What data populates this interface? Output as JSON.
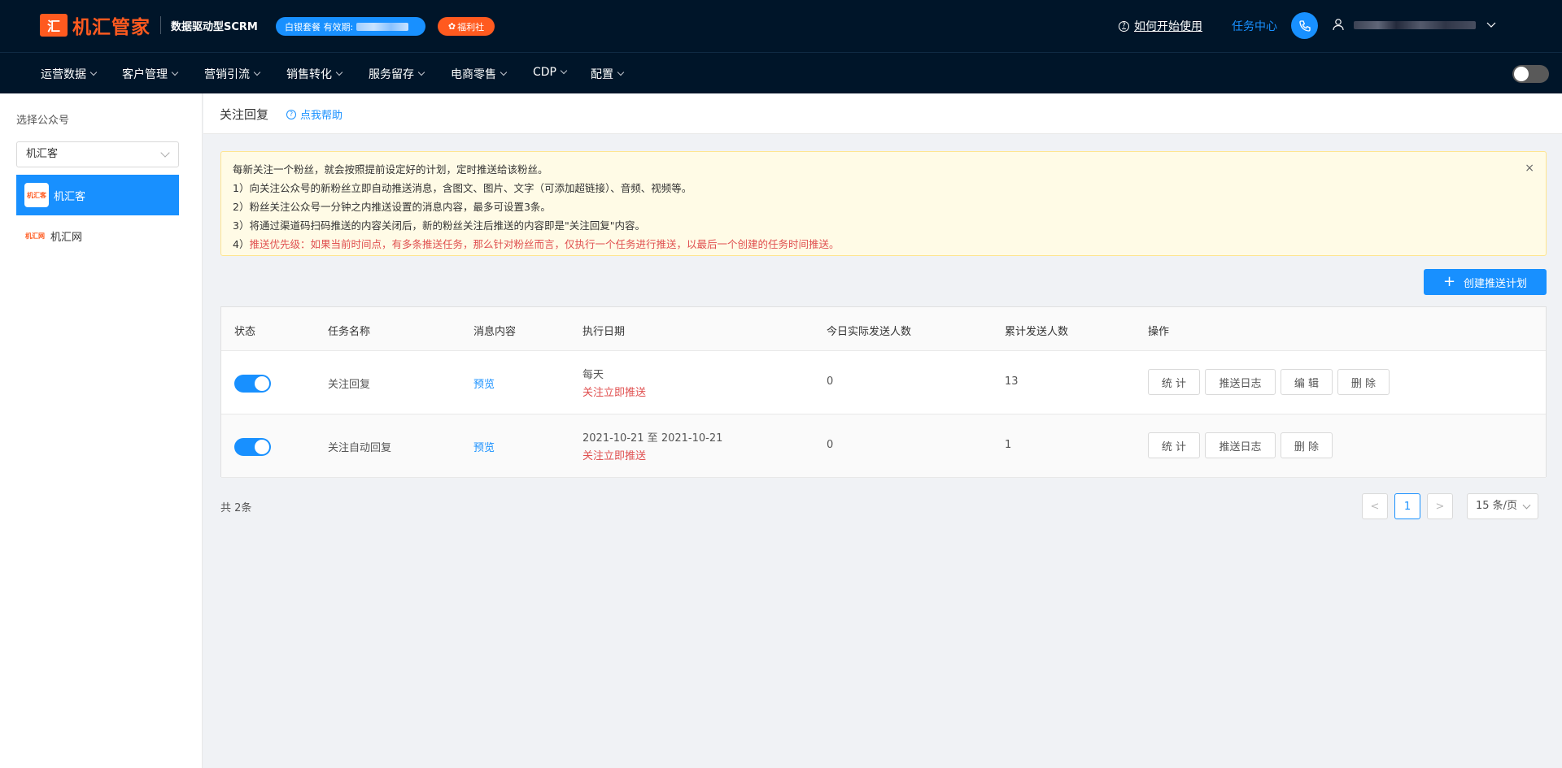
{
  "header": {
    "logo_mark": "汇",
    "logo_text": "机汇管家",
    "slogan": "数据驱动型SCRM",
    "plan_label": "白银套餐  有效期:",
    "welfare_label": "福利社",
    "help_label": "如何开始使用",
    "task_center": "任务中心"
  },
  "nav": {
    "items": [
      "运营数据",
      "客户管理",
      "营销引流",
      "销售转化",
      "服务留存",
      "电商零售",
      "CDP",
      "配置"
    ]
  },
  "sidebar": {
    "title": "选择公众号",
    "select_value": "机汇客",
    "accounts": [
      {
        "logo": "机汇客",
        "name": "机汇客",
        "active": true
      },
      {
        "logo": "机汇网",
        "name": "机汇网",
        "active": false
      }
    ]
  },
  "page": {
    "title": "关注回复",
    "help": "点我帮助"
  },
  "notice": {
    "line0": "每新关注一个粉丝，就会按照提前设定好的计划，定时推送给该粉丝。",
    "line1": "1）向关注公众号的新粉丝立即自动推送消息，含图文、图片、文字（可添加超链接）、音频、视频等。",
    "line2": "2）粉丝关注公众号一分钟之内推送设置的消息内容，最多可设置3条。",
    "line3": "3）将通过渠道码扫码推送的内容关闭后，新的粉丝关注后推送的内容即是\"关注回复\"内容。",
    "line4_prefix": "4）",
    "line4": "推送优先级：如果当前时间点，有多条推送任务，那么针对粉丝而言，仅执行一个任务进行推送，以最后一个创建的任务时间推送。",
    "close": "×"
  },
  "create_button": "创建推送计划",
  "table": {
    "headers": {
      "status": "状态",
      "name": "任务名称",
      "content": "消息内容",
      "date": "执行日期",
      "today": "今日实际发送人数",
      "total": "累计发送人数",
      "ops": "操作"
    },
    "rows": [
      {
        "enabled": true,
        "name": "关注回复",
        "content": "预览",
        "date": "每天",
        "date_note": "关注立即推送",
        "today": "0",
        "total": "13",
        "ops": [
          "统 计",
          "推送日志",
          "编 辑",
          "删 除"
        ]
      },
      {
        "enabled": true,
        "name": "关注自动回复",
        "content": "预览",
        "date": "2021-10-21 至 2021-10-21",
        "date_note": "关注立即推送",
        "today": "0",
        "total": "1",
        "ops": [
          "统 计",
          "推送日志",
          "删 除"
        ]
      }
    ]
  },
  "pagination": {
    "total": "共 2条",
    "prev": "<",
    "current": "1",
    "next": ">",
    "page_size": "15 条/页"
  },
  "colors": {
    "header_bg": "#001529",
    "brand": "#ff5a1f",
    "primary": "#1890ff",
    "warn_text": "#e05050",
    "notice_bg": "#fffbe6"
  }
}
